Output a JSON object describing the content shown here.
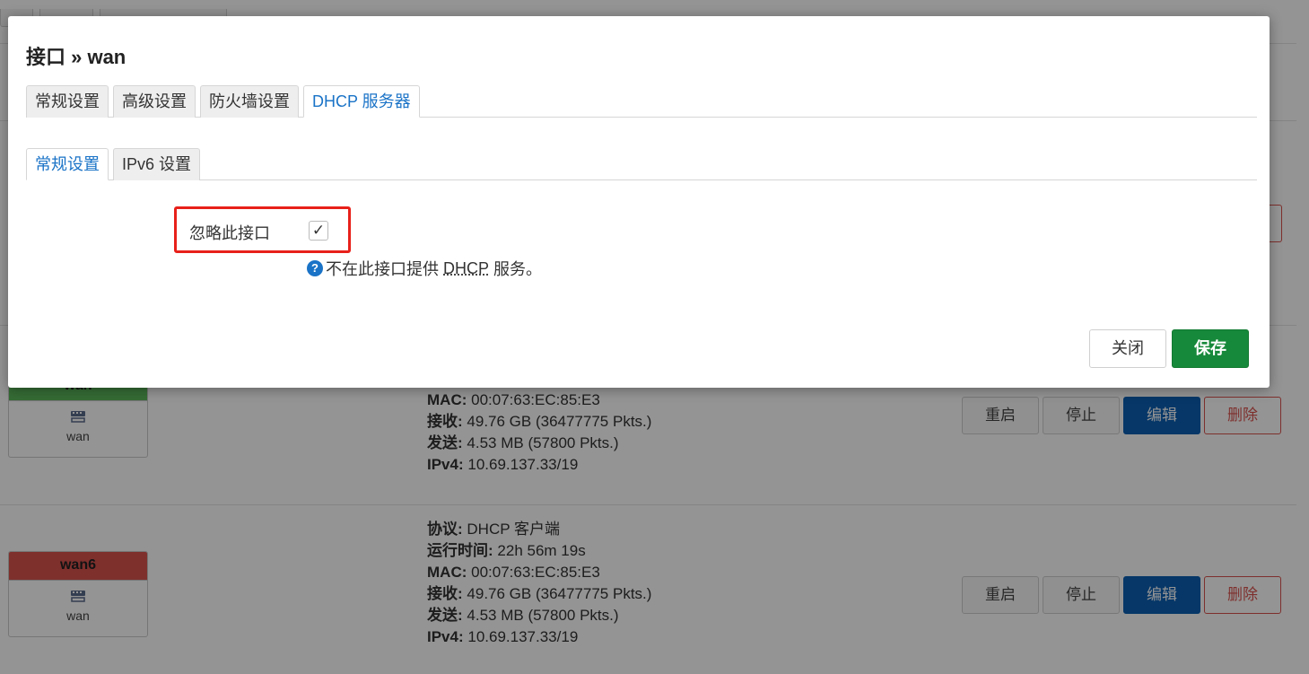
{
  "modal": {
    "title": "接口 » wan",
    "tabs": [
      "常规设置",
      "高级设置",
      "防火墙设置",
      "DHCP 服务器"
    ],
    "subtabs": [
      "常规设置",
      "IPv6 设置"
    ],
    "field": {
      "label": "忽略此接口",
      "checked": true,
      "check_glyph": "✓"
    },
    "help": {
      "icon": "?",
      "prefix": "不在此接口提供",
      "abbr": "DHCP",
      "suffix": "服务。"
    },
    "buttons": {
      "close": "关闭",
      "save": "保存"
    }
  },
  "background": {
    "rows": [
      {
        "name": "wan",
        "device": "wan",
        "header_color": "#5cb85c",
        "info": [
          {
            "key": "MAC:",
            "value": "00:07:63:EC:85:E3"
          },
          {
            "key": "接收:",
            "value": "49.76 GB (36477775 Pkts.)"
          },
          {
            "key": "发送:",
            "value": "4.53 MB (57800 Pkts.)"
          },
          {
            "key": "IPv4:",
            "value": "10.69.137.33/19"
          }
        ],
        "actions": {
          "restart": "重启",
          "stop": "停止",
          "edit": "编辑",
          "delete": "删除"
        }
      },
      {
        "name": "wan6",
        "device": "wan",
        "header_color": "#d9534f",
        "info": [
          {
            "key": "协议:",
            "value": "DHCP 客户端"
          },
          {
            "key": "运行时间:",
            "value": "22h 56m 19s"
          },
          {
            "key": "MAC:",
            "value": "00:07:63:EC:85:E3"
          },
          {
            "key": "接收:",
            "value": "49.76 GB (36477775 Pkts.)"
          },
          {
            "key": "发送:",
            "value": "4.53 MB (57800 Pkts.)"
          },
          {
            "key": "IPv4:",
            "value": "10.69.137.33/19"
          }
        ],
        "actions": {
          "restart": "重启",
          "stop": "停止",
          "edit": "编辑",
          "delete": "删除"
        }
      }
    ]
  }
}
